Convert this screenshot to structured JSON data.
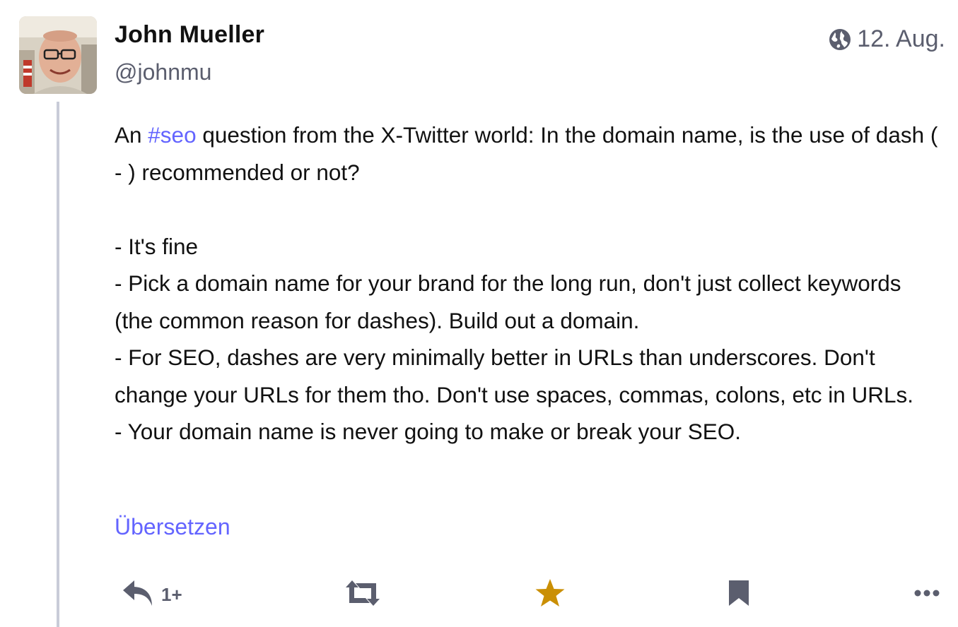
{
  "post": {
    "author": {
      "display_name": "John Mueller",
      "handle": "@johnmu"
    },
    "visibility_icon": "globe-icon",
    "timestamp": "12. Aug.",
    "content": {
      "intro_before": "An ",
      "hashtag": "#seo",
      "intro_after": " question from the X-Twitter world: In the domain name, is the use of dash ( - ) recommended or not?",
      "bullets": [
        "- It's fine",
        "- Pick a domain name for your brand for the long run, don't just collect keywords (the common reason for dashes). Build out a domain.",
        "- For SEO, dashes are very minimally better in URLs than underscores. Don't change your URLs for them tho. Don't use spaces, commas, colons, etc in URLs.",
        "- Your domain name is never going to make or break your SEO."
      ]
    },
    "translate_label": "Übersetzen",
    "actions": {
      "reply": {
        "icon": "reply-icon",
        "count": "1+"
      },
      "boost": {
        "icon": "boost-icon"
      },
      "favourite": {
        "icon": "star-icon",
        "active": true,
        "color": "#ca8f04"
      },
      "bookmark": {
        "icon": "bookmark-icon"
      },
      "more": {
        "icon": "more-icon"
      }
    }
  },
  "colors": {
    "accent": "#6364ff",
    "muted": "#5b5e6e",
    "thread_line": "#c9ccd8",
    "star": "#ca8f04"
  }
}
